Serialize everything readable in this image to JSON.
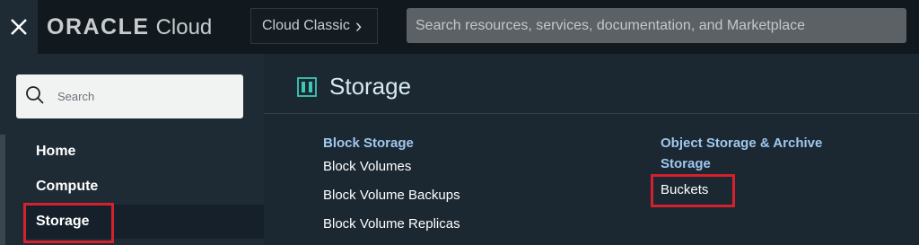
{
  "header": {
    "close_icon": "close-icon",
    "logo_brand": "ORACLE",
    "logo_product": "Cloud",
    "classic_label": "Cloud Classic",
    "classic_chevron": "›",
    "search_placeholder": "Search resources, services, documentation, and Marketplace"
  },
  "sidebar": {
    "search_placeholder": "Search",
    "items": [
      {
        "label": "Home"
      },
      {
        "label": "Compute"
      },
      {
        "label": "Storage"
      }
    ]
  },
  "main": {
    "title": "Storage",
    "columns": [
      {
        "heading": "Block Storage",
        "links": [
          "Block Volumes",
          "Block Volume Backups",
          "Block Volume Replicas"
        ]
      },
      {
        "heading": "Object Storage & Archive Storage",
        "links": [
          "Buckets"
        ]
      }
    ]
  },
  "colors": {
    "highlight": "#d3212d",
    "accent_teal": "#2c8f86",
    "heading_blue": "#9fc8ee"
  }
}
